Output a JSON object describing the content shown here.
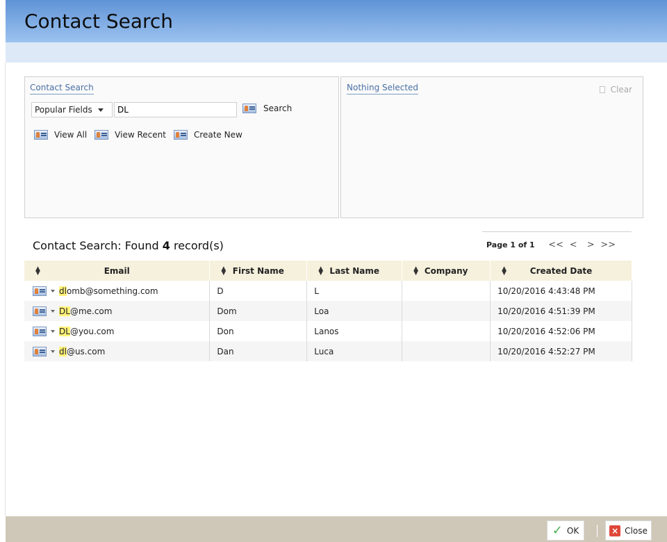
{
  "window": {
    "title": "Contact Search"
  },
  "search_panel": {
    "title": "Contact Search",
    "field_select": "Popular Fields",
    "query": "DL",
    "search_label": "Search",
    "actions": [
      {
        "label": "View All"
      },
      {
        "label": "View Recent"
      },
      {
        "label": "Create New"
      }
    ]
  },
  "selection_panel": {
    "title": "Nothing Selected",
    "clear_label": "Clear"
  },
  "results": {
    "title_prefix": "Contact Search: Found ",
    "count": "4",
    "title_suffix": " record(s)"
  },
  "pager": {
    "label": "Page 1 of 1",
    "first": "<<",
    "prev": "<",
    "next": ">",
    "last": ">>"
  },
  "table": {
    "columns": [
      "Email",
      "First Name",
      "Last Name",
      "Company",
      "Created Date"
    ],
    "rows": [
      {
        "email_hl": "dl",
        "email_rest": "omb@something.com",
        "first": "D",
        "last": "L",
        "company": "",
        "created": "10/20/2016 4:43:48 PM"
      },
      {
        "email_hl": "DL",
        "email_rest": "@me.com",
        "first": "Dom",
        "last": "Loa",
        "company": "",
        "created": "10/20/2016 4:51:39 PM"
      },
      {
        "email_hl": "DL",
        "email_rest": "@you.com",
        "first": "Don",
        "last": "Lanos",
        "company": "",
        "created": "10/20/2016 4:52:06 PM"
      },
      {
        "email_hl": "dl",
        "email_rest": "@us.com",
        "first": "Dan",
        "last": "Luca",
        "company": "",
        "created": "10/20/2016 4:52:27 PM"
      }
    ]
  },
  "footer": {
    "ok_label": "OK",
    "close_label": "Close"
  },
  "colors": {
    "title_gradient_top": "#5f93d7",
    "highlight": "#fff279",
    "footer": "#cfc8b8",
    "header_row": "#f6f1dd"
  }
}
